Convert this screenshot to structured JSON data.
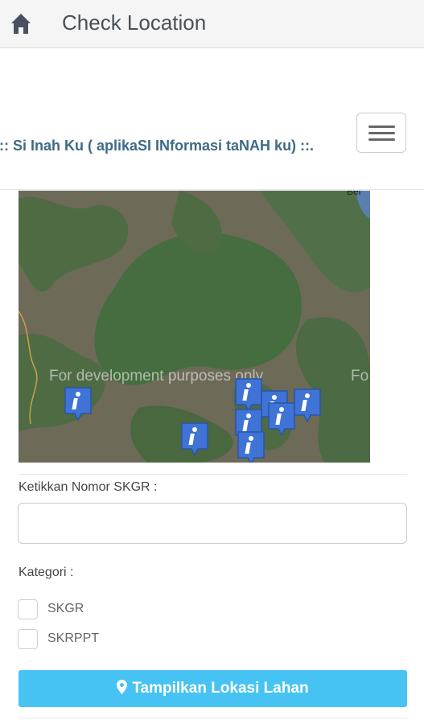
{
  "appbar": {
    "title": "Check Location",
    "home_icon": "home-icon"
  },
  "navbar": {
    "brand": ".:: Si Inah Ku ( aplikaSI INformasi taNAH ku) ::.",
    "menu_icon": "hamburger-menu-icon"
  },
  "map": {
    "watermark": "For development purposes only",
    "watermark_repeat": "Fo",
    "corner_label": "Bel",
    "markers": [
      {
        "name": "map-marker-1"
      },
      {
        "name": "map-marker-2"
      },
      {
        "name": "map-marker-3"
      },
      {
        "name": "map-marker-4"
      },
      {
        "name": "map-marker-5"
      },
      {
        "name": "map-marker-6"
      },
      {
        "name": "map-marker-7"
      },
      {
        "name": "map-marker-8"
      }
    ]
  },
  "form": {
    "skgr_label": "Ketikkan Nomor SKGR :",
    "skgr_value": "",
    "kategori_label": "Kategori :",
    "options": [
      "SKGR",
      "SKRPPT"
    ],
    "submit_label": "Tampilkan Lokasi Lahan"
  },
  "colors": {
    "accent": "#47c3f3",
    "brand": "#3d6b86",
    "marker": "#3f73d6"
  }
}
